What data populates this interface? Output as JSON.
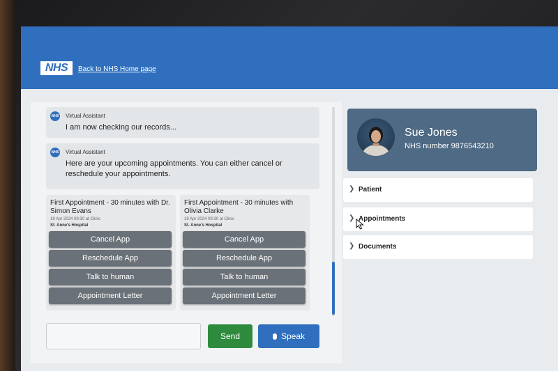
{
  "header": {
    "logo_text": "NHS",
    "back_link": "Back to NHS Home page"
  },
  "chat": {
    "messages": [
      {
        "sender": "Virtual Assistant",
        "avatar_text": "NHS",
        "text": "I am now checking our records..."
      },
      {
        "sender": "Virtual Assistant",
        "avatar_text": "NHS",
        "text": "Here are your upcoming appointments. You can either cancel or reschedule your appointments."
      }
    ],
    "appointments": [
      {
        "title": "First Appointment - 30 minutes with Dr. Simon Evans",
        "meta": "19 Apr 2024 09:30 at Clinic",
        "location": "St. Anne's Hospital",
        "buttons": [
          "Cancel App",
          "Reschedule App",
          "Talk to human",
          "Appointment Letter"
        ]
      },
      {
        "title": "First Appointment - 30 minutes with Olivia Clarke",
        "meta": "19 Apr 2024 09:30 at Clinic",
        "location": "St. Anne's Hospital",
        "buttons": [
          "Cancel App",
          "Reschedule App",
          "Talk to human",
          "Appointment Letter"
        ]
      }
    ],
    "input_value": "",
    "send_label": "Send",
    "speak_label": "Speak"
  },
  "patient": {
    "name": "Sue Jones",
    "nhs_number": "NHS number 9876543210"
  },
  "sections": [
    {
      "label": "Patient",
      "icon": "chevron-right-icon"
    },
    {
      "label": "Appointments",
      "icon": "chevron-right-icon"
    },
    {
      "label": "Documents",
      "icon": "chevron-right-icon"
    }
  ],
  "colors": {
    "brand_blue": "#2f6fbd",
    "send_green": "#2e8b3e",
    "patient_card": "#4f6a84",
    "action_button": "#6b7178"
  }
}
